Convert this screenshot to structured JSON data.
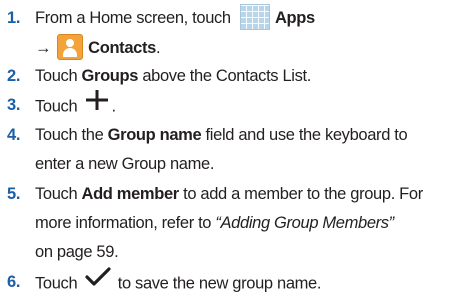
{
  "steps": [
    {
      "number": "1.",
      "line1": {
        "t1": "From a Home screen, touch ",
        "apps_label": "Apps"
      },
      "line2": {
        "arrow": "→",
        "contacts_label": "Contacts",
        "t2": "."
      },
      "icons": [
        "apps-grid-icon",
        "contacts-app-icon"
      ]
    },
    {
      "number": "2.",
      "t1": "Touch ",
      "bold": "Groups",
      "t2": " above the Contacts List."
    },
    {
      "number": "3.",
      "t1": "Touch ",
      "t2": ".",
      "icons": [
        "plus-icon"
      ]
    },
    {
      "number": "4.",
      "line1": {
        "t1": "Touch the ",
        "bold": "Group name",
        "t2": " field and use the keyboard to"
      },
      "line2": {
        "t1": "enter a new Group name."
      }
    },
    {
      "number": "5.",
      "line1": {
        "t1": "Touch ",
        "bold": "Add member",
        "t2": " to add a member to the group. For"
      },
      "line2": {
        "t1": "more information, refer to ",
        "ref": "“Adding Group Members”"
      },
      "line3": {
        "t1": "on page 59."
      }
    },
    {
      "number": "6.",
      "t1": "Touch ",
      "t2": " to save the new group name.",
      "icons": [
        "checkmark-icon"
      ]
    }
  ],
  "colors": {
    "number": "#1a5fa8",
    "text": "#231f20",
    "contacts_icon": "#f3a339",
    "apps_icon": "#b9d6e8"
  }
}
